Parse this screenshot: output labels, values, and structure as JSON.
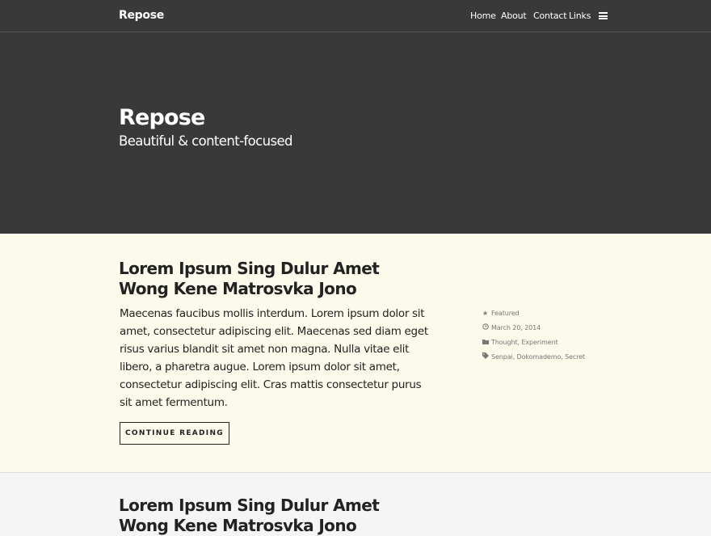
{
  "nav": {
    "brand": "Repose",
    "menu": [
      "Home",
      "About",
      "Contact",
      "Links"
    ],
    "menu_icon": "hamburger-icon"
  },
  "hero": {
    "title": "Repose",
    "subtitle": "Beautiful & content-focused"
  },
  "posts": [
    {
      "title": "Lorem Ipsum Sing Dulur Amet Wong Kene Matrosvka Jono",
      "excerpt": "Maecenas faucibus mollis interdum. Lorem ipsum dolor sit amet, consectetur adipiscing elit. Maecenas sed diam eget risus varius blandit sit amet non magna. Nulla vitae elit libero, a pharetra augue. Lorem ipsum dolor sit amet, consectetur adipiscing elit. Cras mattis consectetur purus sit amet fermentum.",
      "button": "CONTINUE READING",
      "meta": [
        {
          "icon": "star-icon",
          "text": "Featured"
        },
        {
          "icon": "clock-icon",
          "text": "March 20, 2014"
        },
        {
          "icon": "folder-icon",
          "text": "Thought, Experiment"
        },
        {
          "icon": "tag-icon",
          "text": "Senpai, Dokomademo, Secret"
        }
      ]
    },
    {
      "title": "Lorem Ipsum Sing Dulur Amet Wong Kene Matrosvka Jono"
    }
  ]
}
